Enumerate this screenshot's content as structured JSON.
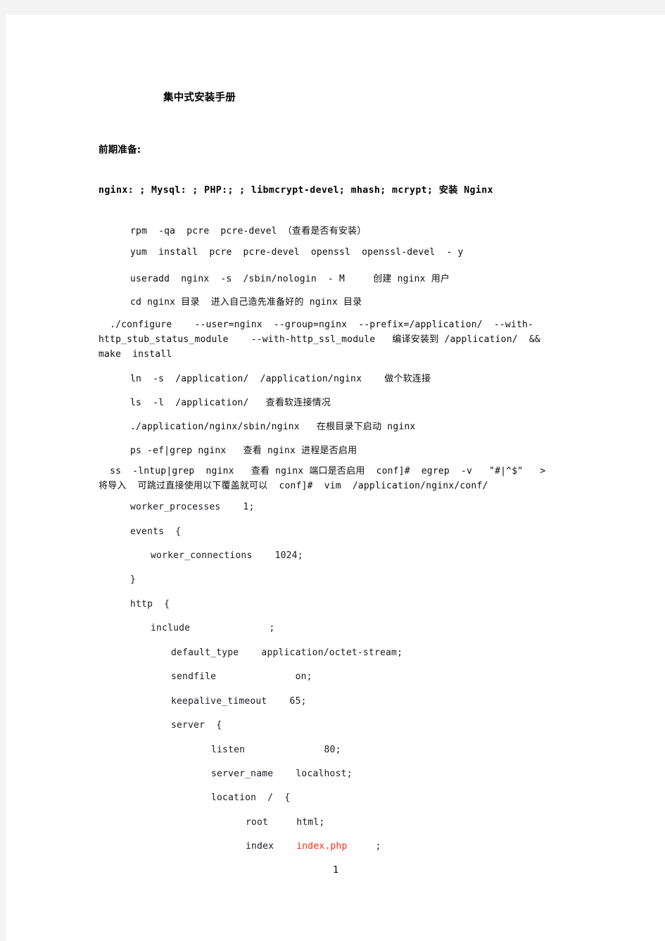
{
  "document": {
    "title": "集中式安装手册",
    "section_heading": "前期准备:",
    "package_line": "nginx: ; Mysql: ; PHP:; ; libmcrypt-devel; mhash; mcrypt; 安装 Nginx",
    "page_number": "1",
    "paper_color": "#ffffff",
    "backdrop_color": "#f4f4f4",
    "highlight_color": "#ff2a16"
  },
  "commands": [
    {
      "text": "rpm  -qa  pcre  pcre-devel （查看是否有安装）"
    },
    {
      "text": "yum  install  pcre  pcre-devel  openssl  openssl-devel  - y"
    },
    {
      "text": "useradd  nginx  -s  /sbin/nologin  - M     创建 nginx 用户"
    },
    {
      "text": "cd nginx 目录  进入自己造先准备好的 nginx 目录"
    }
  ],
  "configure_block": "  ./configure    --user=nginx  --group=nginx  --prefix=/application/  --with-http_stub_status_module    --with-http_ssl_module   编译安装到 /application/  &&  make  install",
  "commands2": [
    {
      "text": "ln  -s  /application/  /application/nginx    做个软连接"
    },
    {
      "text": "ls  -l  /application/   查看软连接情况"
    },
    {
      "text": "./application/nginx/sbin/nginx   在根目录下启动 nginx"
    },
    {
      "text": "ps -ef|grep nginx   查看 nginx 进程是否启用"
    }
  ],
  "long_command": "  ss  -lntup|grep  nginx   查看 nginx 端口是否启用  conf]#  egrep  -v   \"#|^$\"   >    将导入  可跳过直接使用以下覆盖就可以  conf]#  vim  /application/nginx/conf/",
  "nginx_conf": [
    {
      "indent": 0,
      "text": "worker_processes    1;"
    },
    {
      "indent": 0,
      "text": "events  {"
    },
    {
      "indent": 1,
      "text": "worker_connections    1024;"
    },
    {
      "indent": 0,
      "text": "}"
    },
    {
      "indent": 0,
      "text": "http  {"
    },
    {
      "indent": 1,
      "text": "include              ;"
    },
    {
      "indent": 2,
      "text": "default_type    application/octet-stream;"
    },
    {
      "indent": 2,
      "text": "sendfile              on;"
    },
    {
      "indent": 2,
      "text": "keepalive_timeout    65;"
    },
    {
      "indent": 2,
      "text": "server  {"
    },
    {
      "indent": 3,
      "text": "listen              80;"
    },
    {
      "indent": 3,
      "text": "server_name    localhost;"
    },
    {
      "indent": 3,
      "text": "location  /  {"
    },
    {
      "indent": 4,
      "text": "root     html;"
    }
  ],
  "index_line": {
    "key": "index",
    "value": "index.php",
    "terminator": ";"
  }
}
